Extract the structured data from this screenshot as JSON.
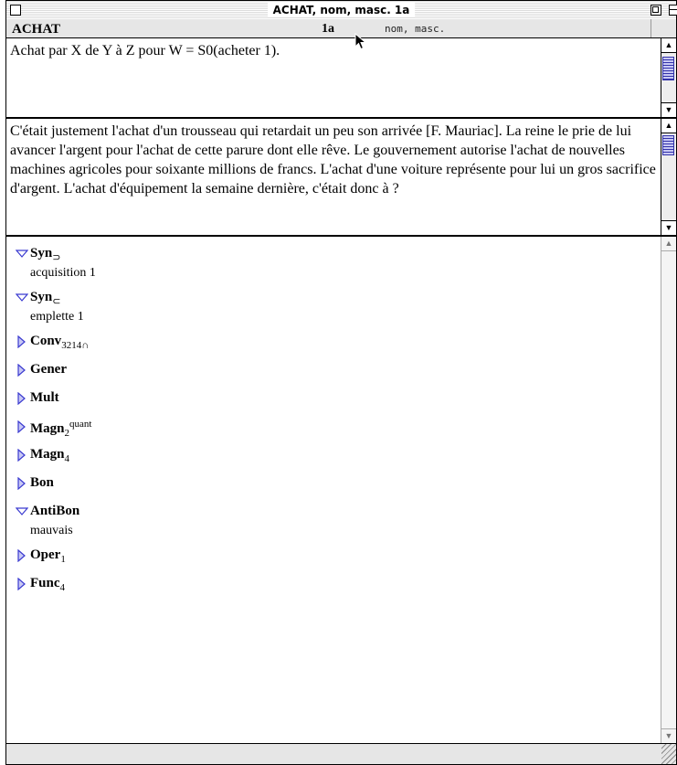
{
  "window": {
    "title": "ACHAT, nom, masc. 1a"
  },
  "header": {
    "lexeme": "ACHAT",
    "number": "1a",
    "grammar": "nom, masc."
  },
  "definition": {
    "text": "Achat par X de Y à Z pour W = S0(acheter 1)."
  },
  "examples": {
    "text": "C'était justement l'achat d'un trousseau qui retardait un peu son arrivée [F. Mauriac].  La reine le prie de lui avancer l'argent pour l'achat de cette parure dont elle rêve.  Le gouvernement autorise l'achat de nouvelles machines agricoles pour soixante millions de francs.  L'achat d'une voiture représente pour lui un gros sacrifice d'argent.  L'achat d'équipement la semaine dernière, c'était donc à ?"
  },
  "functions": [
    {
      "name": "Syn",
      "sub": "⊃",
      "sup": "",
      "expanded": true,
      "value": "acquisition 1"
    },
    {
      "name": "Syn",
      "sub": "⊂",
      "sup": "",
      "expanded": true,
      "value": "emplette 1"
    },
    {
      "name": "Conv",
      "sub": "3214∩",
      "sup": "",
      "expanded": false,
      "value": ""
    },
    {
      "name": "Gener",
      "sub": "",
      "sup": "",
      "expanded": false,
      "value": ""
    },
    {
      "name": "Mult",
      "sub": "",
      "sup": "",
      "expanded": false,
      "value": ""
    },
    {
      "name": "Magn",
      "sub": "2",
      "sup": "quant",
      "expanded": false,
      "value": ""
    },
    {
      "name": "Magn",
      "sub": "4",
      "sup": "",
      "expanded": false,
      "value": ""
    },
    {
      "name": "Bon",
      "sub": "",
      "sup": "",
      "expanded": false,
      "value": ""
    },
    {
      "name": "AntiBon",
      "sub": "",
      "sup": "",
      "expanded": true,
      "value": "mauvais"
    },
    {
      "name": "Oper",
      "sub": "1",
      "sup": "",
      "expanded": false,
      "value": ""
    },
    {
      "name": "Func",
      "sub": "4",
      "sup": "",
      "expanded": false,
      "value": ""
    }
  ],
  "colors": {
    "triangle": "#3a3ad0",
    "scroll_thumb": "#c8c8f4"
  },
  "icons": {
    "expanded": "triangle-down-icon",
    "collapsed": "triangle-right-icon"
  }
}
